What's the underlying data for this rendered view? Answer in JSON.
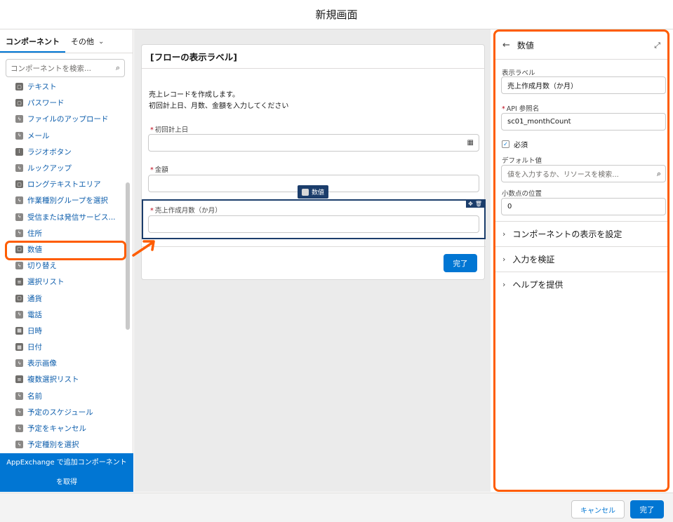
{
  "header": {
    "title": "新規画面"
  },
  "left_panel": {
    "tabs": [
      {
        "label": "コンポーネント"
      },
      {
        "label": "その他"
      }
    ],
    "search_placeholder": "コンポーネントを検索...",
    "items": [
      {
        "label": "テキスト",
        "icon": "input-icon"
      },
      {
        "label": "パスワード",
        "icon": "input-icon"
      },
      {
        "label": "ファイルのアップロード",
        "icon": "bolt-icon"
      },
      {
        "label": "メール",
        "icon": "bolt-icon"
      },
      {
        "label": "ラジオボタン",
        "icon": "radio-icon"
      },
      {
        "label": "ルックアップ",
        "icon": "bolt-icon"
      },
      {
        "label": "ロングテキストエリア",
        "icon": "input-icon"
      },
      {
        "label": "作業種別グループを選択",
        "icon": "bolt-icon"
      },
      {
        "label": "受信または発信サービス...",
        "icon": "bolt-icon"
      },
      {
        "label": "住所",
        "icon": "bolt-icon"
      },
      {
        "label": "数値",
        "icon": "input-icon"
      },
      {
        "label": "切り替え",
        "icon": "bolt-icon"
      },
      {
        "label": "選択リスト",
        "icon": "list-icon"
      },
      {
        "label": "通貨",
        "icon": "input-icon"
      },
      {
        "label": "電話",
        "icon": "bolt-icon"
      },
      {
        "label": "日時",
        "icon": "calendar-icon"
      },
      {
        "label": "日付",
        "icon": "calendar-icon"
      },
      {
        "label": "表示画像",
        "icon": "bolt-icon"
      },
      {
        "label": "複数選択リスト",
        "icon": "list-icon"
      },
      {
        "label": "名前",
        "icon": "bolt-icon"
      },
      {
        "label": "予定のスケジュール",
        "icon": "bolt-icon"
      },
      {
        "label": "予定をキャンセル",
        "icon": "bolt-icon"
      },
      {
        "label": "予定種別を選択",
        "icon": "bolt-icon"
      }
    ],
    "appexchange_label": "AppExchange で追加コンポーネントを取得"
  },
  "canvas": {
    "card_title": "[フローの表示ラベル]",
    "desc_line1": "売上レコードを作成します。",
    "desc_line2": "初回計上日、月数、金額を入力してください",
    "fields": [
      {
        "label": "初回計上日"
      },
      {
        "label": "金額"
      },
      {
        "label": "売上作成月数（か月）"
      }
    ],
    "badge_label": "数値",
    "done_label": "完了"
  },
  "right_panel": {
    "title": "数値",
    "display_label_label": "表示ラベル",
    "display_label_value": "売上作成月数（か月）",
    "api_label": "API 参照名",
    "api_value": "sc01_monthCount",
    "required_label": "必須",
    "default_label": "デフォルト値",
    "default_placeholder": "値を入力するか、リソースを検索...",
    "decimal_label": "小数点の位置",
    "decimal_value": "0",
    "sections": [
      {
        "label": "コンポーネントの表示を設定"
      },
      {
        "label": "入力を検証"
      },
      {
        "label": "ヘルプを提供"
      }
    ]
  },
  "footer": {
    "cancel_label": "キャンセル",
    "done_label": "完了"
  },
  "colors": {
    "brand": "#0176d3",
    "highlight": "#fe5c00",
    "selection": "#1b3d6b"
  }
}
